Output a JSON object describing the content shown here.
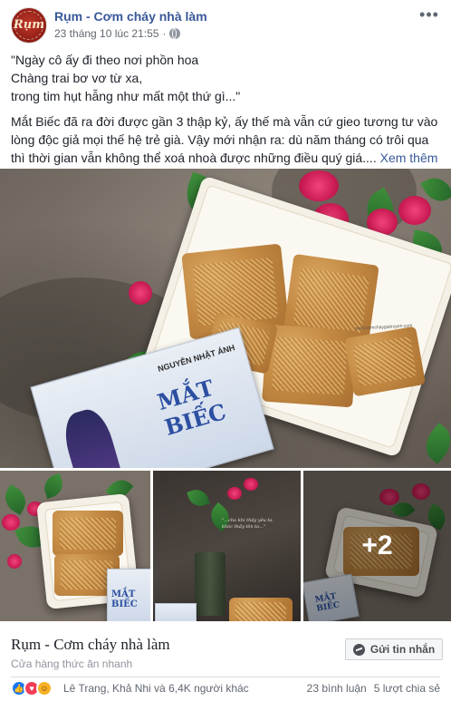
{
  "header": {
    "page_name": "Rụm - Cơm cháy nhà làm",
    "timestamp": "23 tháng 10 lúc 21:55",
    "avatar_text": "Rụm",
    "more_glyph": "•••"
  },
  "post": {
    "quote_lines": [
      "\"Ngày cô ấy đi theo nơi phồn hoa",
      "Chàng trai bơ vơ từ xa,",
      "trong tim hụt hẫng như mất một thứ gì...\""
    ],
    "body": "Mắt Biếc đã ra đời được gần 3 thập kỷ, ấy thế mà vẫn cứ gieo tương tư vào lòng độc giả mọi thế hệ trẻ già. Vậy mới nhận ra: dù năm tháng có trôi qua thì thời gian vẫn không thể xoá nhoà được những điều quý giá....",
    "see_more": "Xem thêm"
  },
  "photos": {
    "book_author": "NGUYỄN NHẬT ÁNH",
    "book_title": "MẮT BIẾC",
    "watermark": "www.comchaygiatruyen.com",
    "calligraphy": "\"...cho khi thấy yêu ta, khóc thấy tên ta...\"",
    "more_count": "+2"
  },
  "footer": {
    "page_name": "Rụm - Cơm cháy nhà làm",
    "category": "Cửa hàng thức ăn nhanh",
    "message_button": "Gửi tin nhắn"
  },
  "engagement": {
    "reaction_icons": [
      "like-icon",
      "love-icon",
      "haha-icon"
    ],
    "reactors": "Lê Trang, Khả Nhi và 6,4K người khác",
    "comments": "23 bình luận",
    "shares": "5 lượt chia sẻ"
  },
  "colors": {
    "link": "#385898",
    "like": "#1877f2",
    "love": "#f33e58",
    "haha": "#f7b125"
  }
}
